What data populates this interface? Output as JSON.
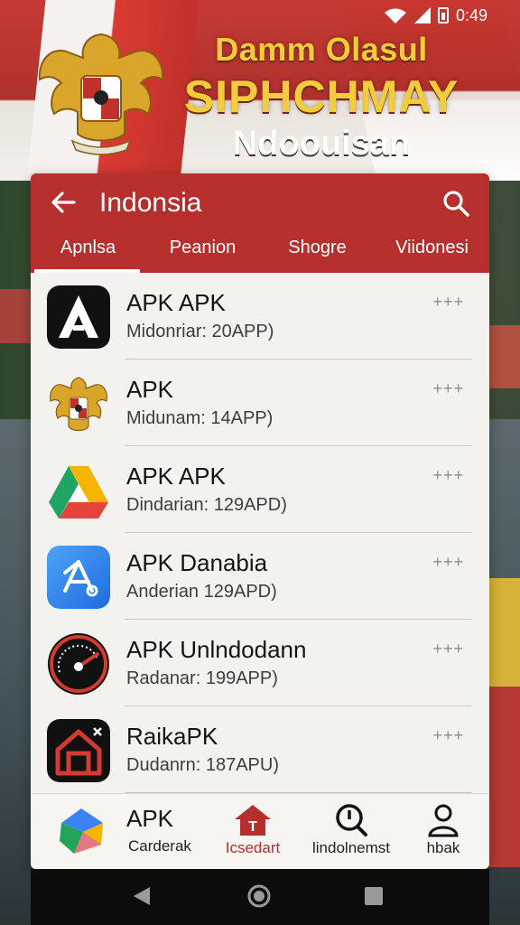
{
  "status": {
    "time": "0:49"
  },
  "banner": {
    "line1": "Damm Olasul",
    "line2": "SIPHCHMAY",
    "line3": "Ndoouisan"
  },
  "appbar": {
    "title": "Indonsia",
    "tabs": [
      "Apnlsa",
      "Peanion",
      "Shogre",
      "Viidonesi"
    ],
    "active_tab": 0
  },
  "apps": [
    {
      "name": "APK APK",
      "sub": "Midonriar: 20APP)",
      "more": "+++",
      "icon": "letter-a-icon"
    },
    {
      "name": "APK",
      "sub": "Midunam: 14APP)",
      "more": "+++",
      "icon": "garuda-emblem-icon"
    },
    {
      "name": "APK APK",
      "sub": "Dindarian: 129APD)",
      "more": "+++",
      "icon": "triangle-drive-icon"
    },
    {
      "name": "APK Danabia",
      "sub": "Anderian 129APD)",
      "more": "+++",
      "icon": "blue-share-icon"
    },
    {
      "name": "APK Unlndodann",
      "sub": "Radanar: 199APP)",
      "more": "+++",
      "icon": "speedometer-icon"
    },
    {
      "name": "RaikaPK",
      "sub": "Dudanrn: 187APU)",
      "more": "+++",
      "icon": "red-house-icon"
    }
  ],
  "bottom_nav": {
    "item1_title": "APK",
    "item1_label": "Carderak",
    "item2_label": "Icsedart",
    "item3_label": "lindolnemst",
    "item4_label": "hbak"
  },
  "colors": {
    "accent": "#b52f2c",
    "card_bg": "#f4f2ee",
    "gold": "#f3cc3c"
  }
}
